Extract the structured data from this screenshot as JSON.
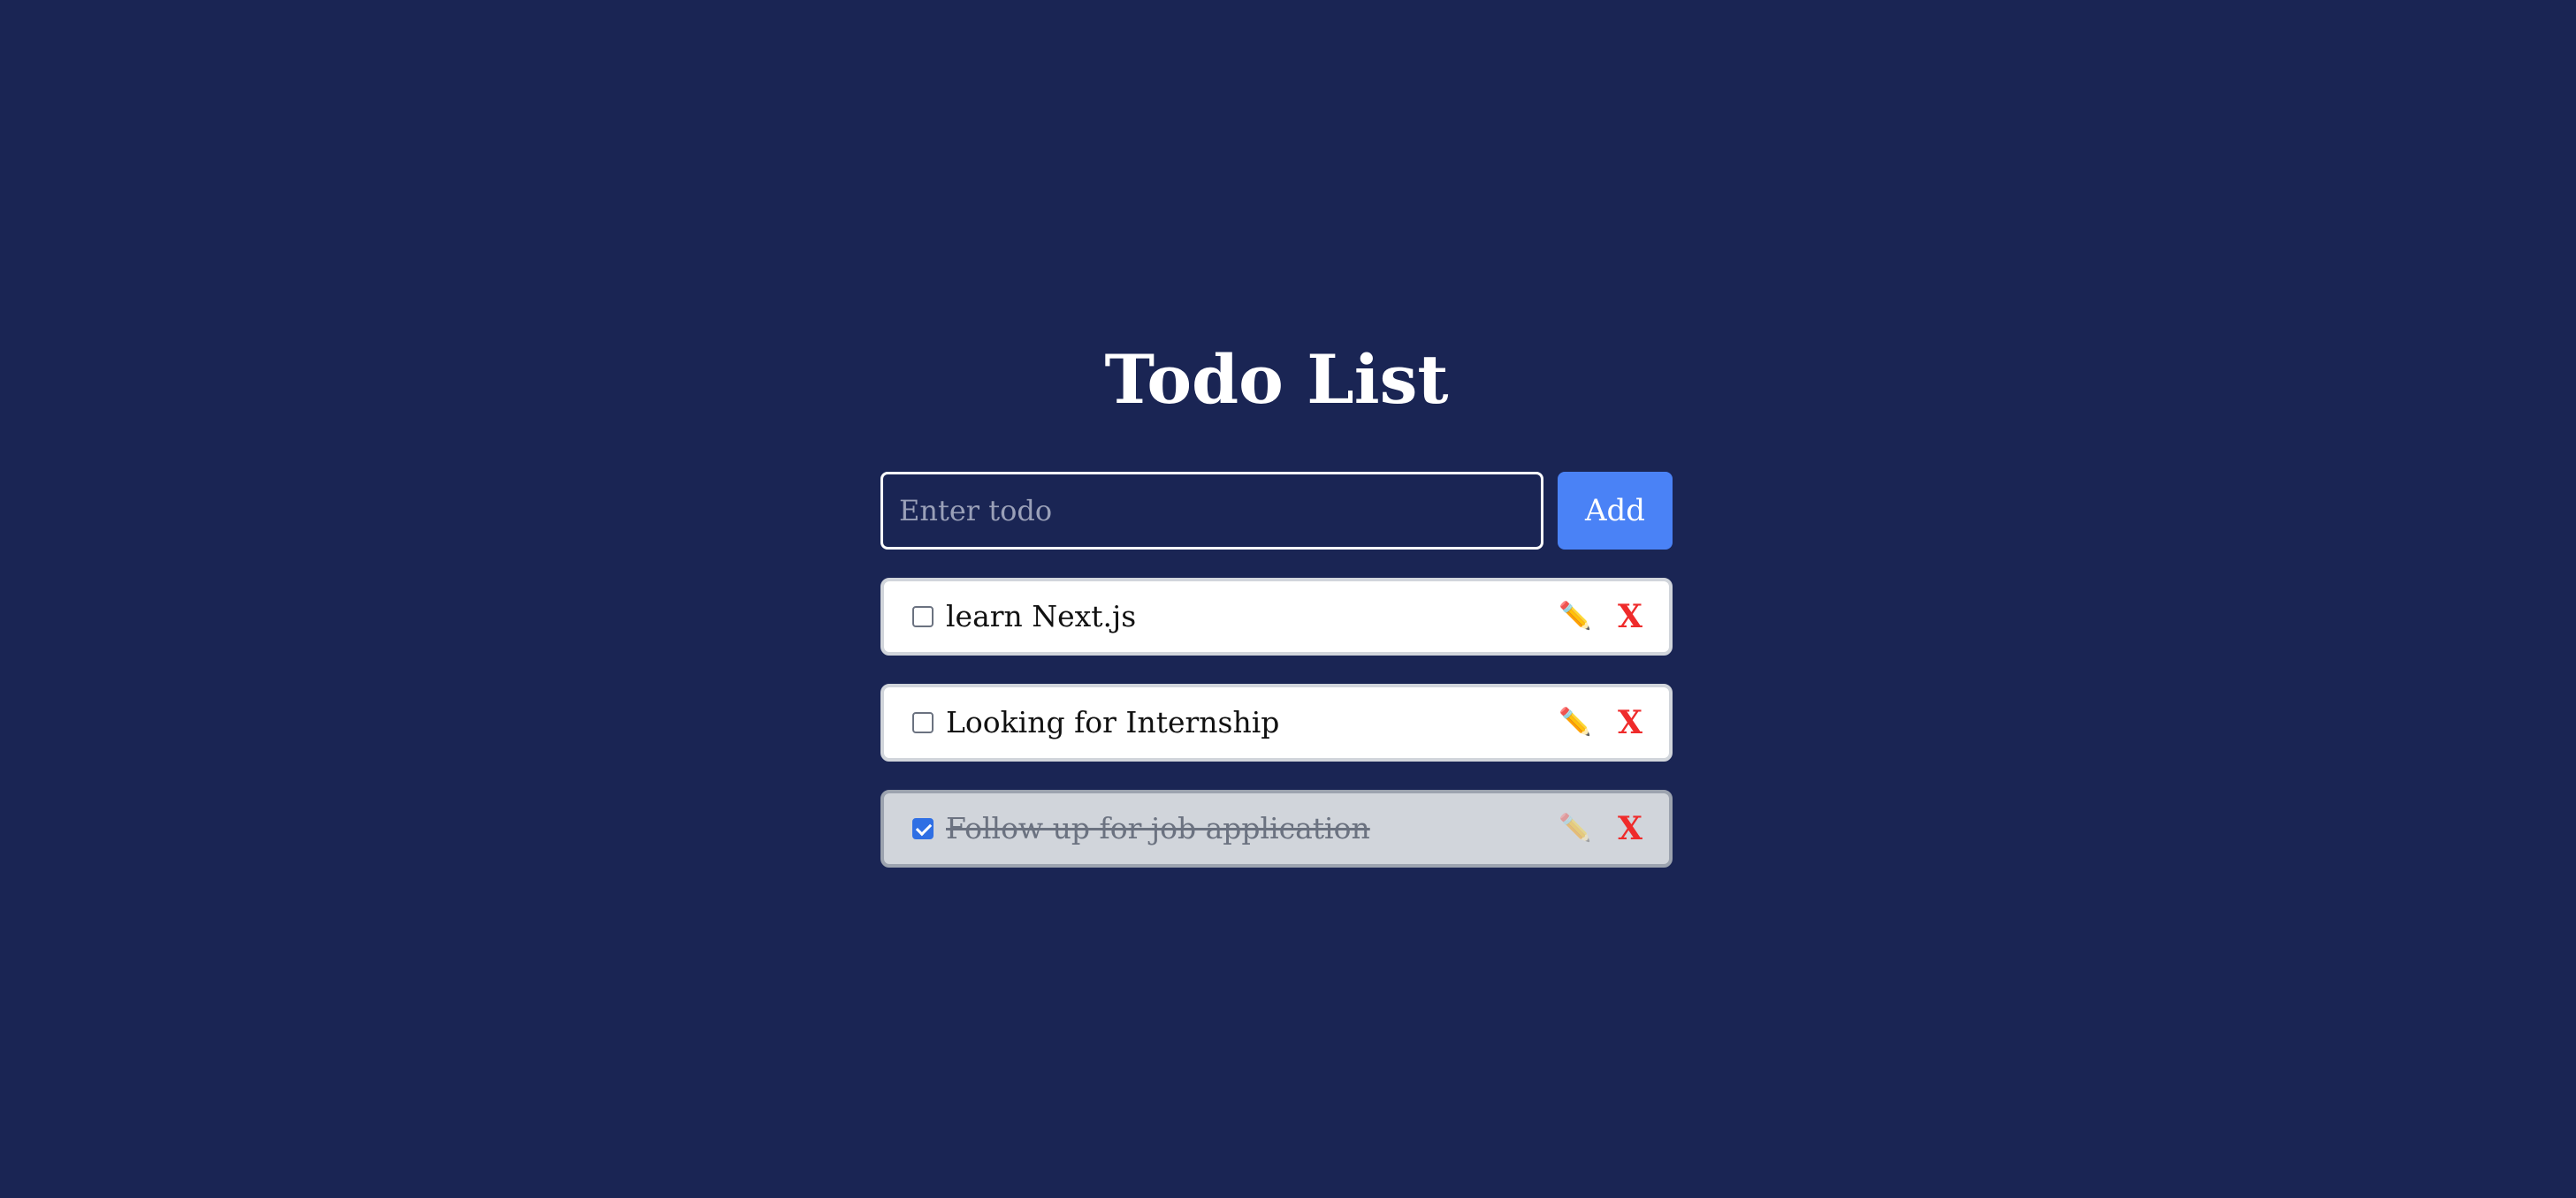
{
  "title": "Todo List",
  "form": {
    "placeholder": "Enter todo",
    "value": "",
    "add_label": "Add"
  },
  "todos": [
    {
      "text": "learn Next.js",
      "completed": false,
      "edit_icon": "✏️",
      "delete_label": "X"
    },
    {
      "text": "Looking for Internship",
      "completed": false,
      "edit_icon": "✏️",
      "delete_label": "X"
    },
    {
      "text": "Follow up for job application",
      "completed": true,
      "edit_icon": "✏️",
      "delete_label": "X"
    }
  ],
  "colors": {
    "background": "#1a2554",
    "accent": "#4a82f6",
    "delete": "#ef2b2b"
  }
}
